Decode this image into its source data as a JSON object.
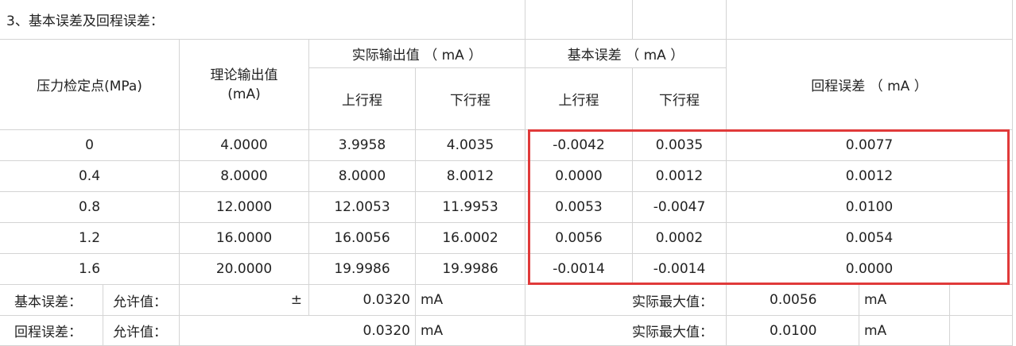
{
  "section_title": "3、基本误差及回程误差：",
  "headers": {
    "pressure_point": "压力检定点(MPa)",
    "theoretical_output_line1": "理论输出值",
    "theoretical_output_line2": "(mA)",
    "actual_output": "实际输出值 （ mA ）",
    "basic_error": "基本误差 （ mA ）",
    "hysteresis_error": "回程误差 （ mA ）",
    "up_stroke": "上行程",
    "down_stroke": "下行程"
  },
  "rows": [
    {
      "point": "0",
      "theory": "4.0000",
      "act_up": "3.9958",
      "act_down": "4.0035",
      "err_up": "-0.0042",
      "err_down": "0.0035",
      "hyst": "0.0077"
    },
    {
      "point": "0.4",
      "theory": "8.0000",
      "act_up": "8.0000",
      "act_down": "8.0012",
      "err_up": "0.0000",
      "err_down": "0.0012",
      "hyst": "0.0012"
    },
    {
      "point": "0.8",
      "theory": "12.0000",
      "act_up": "12.0053",
      "act_down": "11.9953",
      "err_up": "0.0053",
      "err_down": "-0.0047",
      "hyst": "0.0100"
    },
    {
      "point": "1.2",
      "theory": "16.0000",
      "act_up": "16.0056",
      "act_down": "16.0002",
      "err_up": "0.0056",
      "err_down": "0.0002",
      "hyst": "0.0054"
    },
    {
      "point": "1.6",
      "theory": "20.0000",
      "act_up": "19.9986",
      "act_down": "19.9986",
      "err_up": "-0.0014",
      "err_down": "-0.0014",
      "hyst": "0.0000"
    }
  ],
  "summary": [
    {
      "label": "基本误差：",
      "allow_label": "允许值：",
      "sign": "±",
      "allow_value": "0.0320",
      "unit": "mA",
      "max_label": "实际最大值：",
      "max_value": "0.0056",
      "max_unit": "mA"
    },
    {
      "label": "回程误差：",
      "allow_label": "允许值：",
      "sign": "",
      "allow_value": "0.0320",
      "unit": "mA",
      "max_label": "实际最大值：",
      "max_value": "0.0100",
      "max_unit": "mA"
    }
  ],
  "highlight_color": "#e03a3a",
  "grid_color": "#d4d4d4"
}
